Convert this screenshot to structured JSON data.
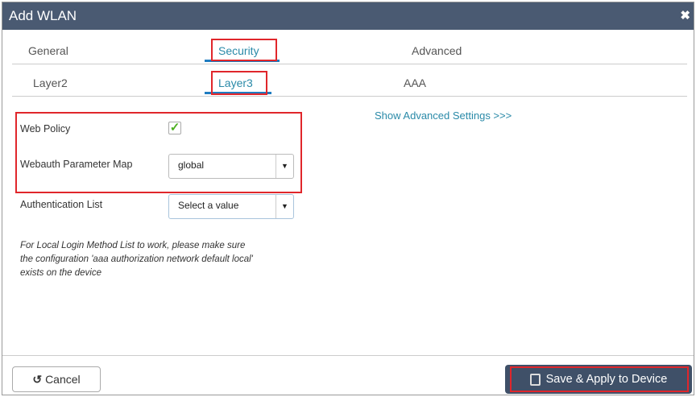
{
  "dialog": {
    "title": "Add WLAN",
    "close_icon": "close-icon"
  },
  "tabs": [
    {
      "label": "General"
    },
    {
      "label": "Security",
      "active": true
    },
    {
      "label": "Advanced"
    }
  ],
  "subtabs": [
    {
      "label": "Layer2"
    },
    {
      "label": "Layer3",
      "active": true
    },
    {
      "label": "AAA"
    }
  ],
  "show_advanced": "Show Advanced Settings >>>",
  "form": {
    "web_policy": {
      "label": "Web Policy",
      "checked": true
    },
    "webauth_map": {
      "label": "Webauth Parameter Map",
      "value": "global"
    },
    "auth_list": {
      "label": "Authentication List",
      "value": "Select a value"
    }
  },
  "note": "For Local Login Method List to work, please make sure the configuration 'aaa authorization network default local' exists on the device",
  "footer": {
    "cancel": "Cancel",
    "save": "Save & Apply to Device"
  },
  "colors": {
    "header": "#4a5a72",
    "accent": "#2a8aa8",
    "highlight": "#e0262b"
  }
}
